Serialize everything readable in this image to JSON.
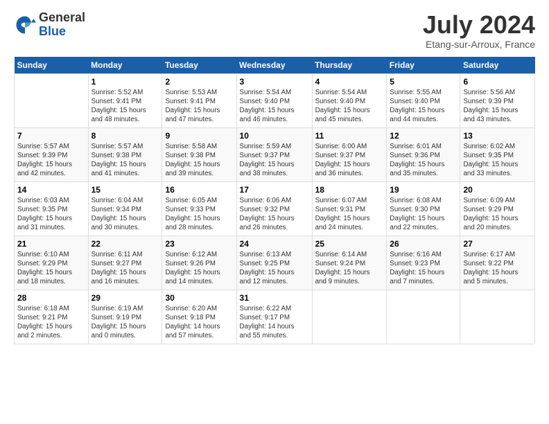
{
  "header": {
    "logo_general": "General",
    "logo_blue": "Blue",
    "month_title": "July 2024",
    "location": "Etang-sur-Arroux, France"
  },
  "weekdays": [
    "Sunday",
    "Monday",
    "Tuesday",
    "Wednesday",
    "Thursday",
    "Friday",
    "Saturday"
  ],
  "weeks": [
    [
      {
        "day": "",
        "info": ""
      },
      {
        "day": "1",
        "info": "Sunrise: 5:52 AM\nSunset: 9:41 PM\nDaylight: 15 hours\nand 48 minutes."
      },
      {
        "day": "2",
        "info": "Sunrise: 5:53 AM\nSunset: 9:41 PM\nDaylight: 15 hours\nand 47 minutes."
      },
      {
        "day": "3",
        "info": "Sunrise: 5:54 AM\nSunset: 9:40 PM\nDaylight: 15 hours\nand 46 minutes."
      },
      {
        "day": "4",
        "info": "Sunrise: 5:54 AM\nSunset: 9:40 PM\nDaylight: 15 hours\nand 45 minutes."
      },
      {
        "day": "5",
        "info": "Sunrise: 5:55 AM\nSunset: 9:40 PM\nDaylight: 15 hours\nand 44 minutes."
      },
      {
        "day": "6",
        "info": "Sunrise: 5:56 AM\nSunset: 9:39 PM\nDaylight: 15 hours\nand 43 minutes."
      }
    ],
    [
      {
        "day": "7",
        "info": "Sunrise: 5:57 AM\nSunset: 9:39 PM\nDaylight: 15 hours\nand 42 minutes."
      },
      {
        "day": "8",
        "info": "Sunrise: 5:57 AM\nSunset: 9:38 PM\nDaylight: 15 hours\nand 41 minutes."
      },
      {
        "day": "9",
        "info": "Sunrise: 5:58 AM\nSunset: 9:38 PM\nDaylight: 15 hours\nand 39 minutes."
      },
      {
        "day": "10",
        "info": "Sunrise: 5:59 AM\nSunset: 9:37 PM\nDaylight: 15 hours\nand 38 minutes."
      },
      {
        "day": "11",
        "info": "Sunrise: 6:00 AM\nSunset: 9:37 PM\nDaylight: 15 hours\nand 36 minutes."
      },
      {
        "day": "12",
        "info": "Sunrise: 6:01 AM\nSunset: 9:36 PM\nDaylight: 15 hours\nand 35 minutes."
      },
      {
        "day": "13",
        "info": "Sunrise: 6:02 AM\nSunset: 9:35 PM\nDaylight: 15 hours\nand 33 minutes."
      }
    ],
    [
      {
        "day": "14",
        "info": "Sunrise: 6:03 AM\nSunset: 9:35 PM\nDaylight: 15 hours\nand 31 minutes."
      },
      {
        "day": "15",
        "info": "Sunrise: 6:04 AM\nSunset: 9:34 PM\nDaylight: 15 hours\nand 30 minutes."
      },
      {
        "day": "16",
        "info": "Sunrise: 6:05 AM\nSunset: 9:33 PM\nDaylight: 15 hours\nand 28 minutes."
      },
      {
        "day": "17",
        "info": "Sunrise: 6:06 AM\nSunset: 9:32 PM\nDaylight: 15 hours\nand 26 minutes."
      },
      {
        "day": "18",
        "info": "Sunrise: 6:07 AM\nSunset: 9:31 PM\nDaylight: 15 hours\nand 24 minutes."
      },
      {
        "day": "19",
        "info": "Sunrise: 6:08 AM\nSunset: 9:30 PM\nDaylight: 15 hours\nand 22 minutes."
      },
      {
        "day": "20",
        "info": "Sunrise: 6:09 AM\nSunset: 9:29 PM\nDaylight: 15 hours\nand 20 minutes."
      }
    ],
    [
      {
        "day": "21",
        "info": "Sunrise: 6:10 AM\nSunset: 9:29 PM\nDaylight: 15 hours\nand 18 minutes."
      },
      {
        "day": "22",
        "info": "Sunrise: 6:11 AM\nSunset: 9:27 PM\nDaylight: 15 hours\nand 16 minutes."
      },
      {
        "day": "23",
        "info": "Sunrise: 6:12 AM\nSunset: 9:26 PM\nDaylight: 15 hours\nand 14 minutes."
      },
      {
        "day": "24",
        "info": "Sunrise: 6:13 AM\nSunset: 9:25 PM\nDaylight: 15 hours\nand 12 minutes."
      },
      {
        "day": "25",
        "info": "Sunrise: 6:14 AM\nSunset: 9:24 PM\nDaylight: 15 hours\nand 9 minutes."
      },
      {
        "day": "26",
        "info": "Sunrise: 6:16 AM\nSunset: 9:23 PM\nDaylight: 15 hours\nand 7 minutes."
      },
      {
        "day": "27",
        "info": "Sunrise: 6:17 AM\nSunset: 9:22 PM\nDaylight: 15 hours\nand 5 minutes."
      }
    ],
    [
      {
        "day": "28",
        "info": "Sunrise: 6:18 AM\nSunset: 9:21 PM\nDaylight: 15 hours\nand 2 minutes."
      },
      {
        "day": "29",
        "info": "Sunrise: 6:19 AM\nSunset: 9:19 PM\nDaylight: 15 hours\nand 0 minutes."
      },
      {
        "day": "30",
        "info": "Sunrise: 6:20 AM\nSunset: 9:18 PM\nDaylight: 14 hours\nand 57 minutes."
      },
      {
        "day": "31",
        "info": "Sunrise: 6:22 AM\nSunset: 9:17 PM\nDaylight: 14 hours\nand 55 minutes."
      },
      {
        "day": "",
        "info": ""
      },
      {
        "day": "",
        "info": ""
      },
      {
        "day": "",
        "info": ""
      }
    ]
  ]
}
